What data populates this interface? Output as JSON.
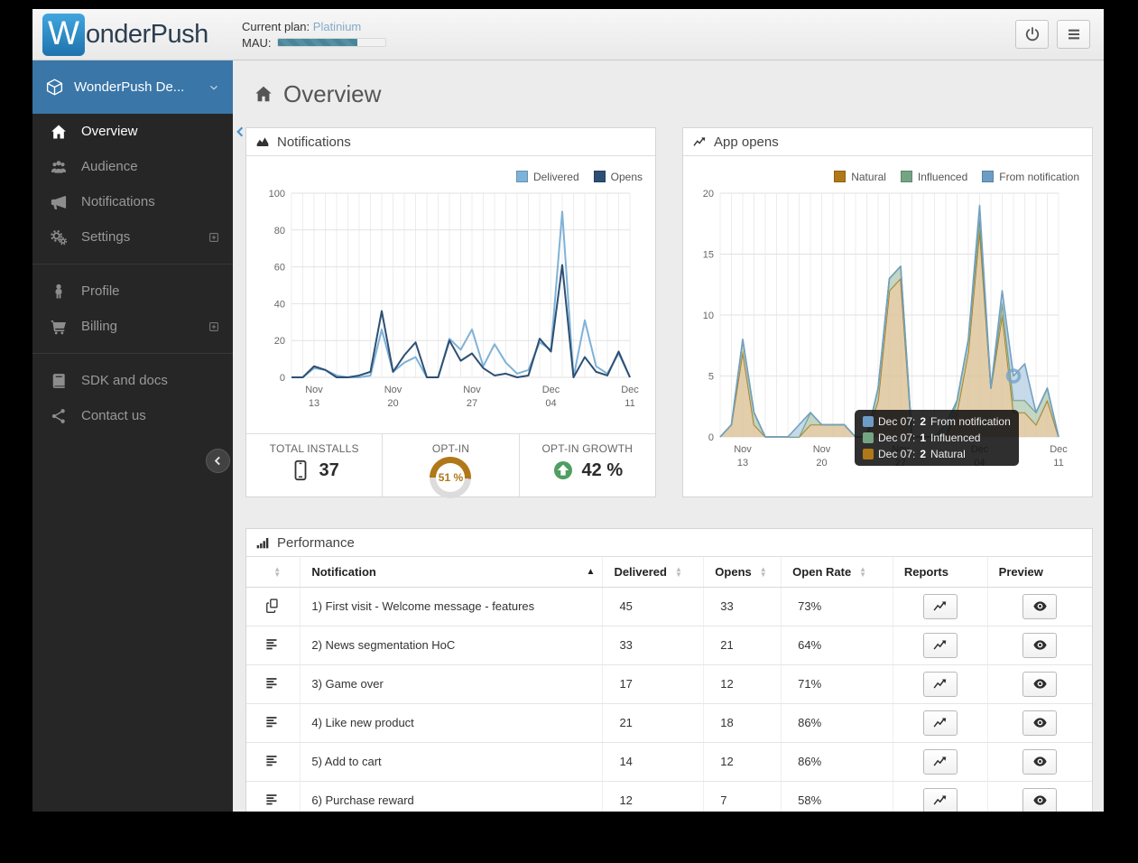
{
  "topbar": {
    "brand": {
      "logo_letter": "W",
      "name": "onderPush"
    },
    "plan": {
      "label": "Current plan:",
      "value": "Platinium"
    },
    "mau": {
      "label": "MAU:",
      "percent": 74
    }
  },
  "sidebar": {
    "app_selector": {
      "label": "WonderPush De...",
      "icon": "cube-icon"
    },
    "sections": [
      {
        "items": [
          {
            "label": "Overview",
            "icon": "home-icon",
            "active": true
          },
          {
            "label": "Audience",
            "icon": "users-icon"
          },
          {
            "label": "Notifications",
            "icon": "megaphone-icon"
          },
          {
            "label": "Settings",
            "icon": "gears-icon",
            "expandable": true
          }
        ]
      },
      {
        "items": [
          {
            "label": "Profile",
            "icon": "person-icon"
          },
          {
            "label": "Billing",
            "icon": "cart-icon",
            "expandable": true
          }
        ]
      },
      {
        "items": [
          {
            "label": "SDK and docs",
            "icon": "book-icon"
          },
          {
            "label": "Contact us",
            "icon": "share-icon"
          }
        ]
      }
    ]
  },
  "main": {
    "page_title": "Overview"
  },
  "panels": {
    "notifications": {
      "title": "Notifications",
      "legend": [
        {
          "label": "Delivered",
          "color": "#7fb2d8"
        },
        {
          "label": "Opens",
          "color": "#2e4f73"
        }
      ]
    },
    "app_opens": {
      "title": "App opens",
      "legend": [
        {
          "label": "Natural",
          "color": "#b07818"
        },
        {
          "label": "Influenced",
          "color": "#74a483"
        },
        {
          "label": "From notification",
          "color": "#6d9dc6"
        }
      ],
      "tooltip": [
        {
          "date": "Dec 07:",
          "value": "2",
          "label": "From notification",
          "color": "#6d9dc6"
        },
        {
          "date": "Dec 07:",
          "value": "1",
          "label": "Influenced",
          "color": "#74a483"
        },
        {
          "date": "Dec 07:",
          "value": "2",
          "label": "Natural",
          "color": "#b07818"
        }
      ]
    },
    "performance": {
      "title": "Performance",
      "columns": {
        "notification": "Notification",
        "delivered": "Delivered",
        "opens": "Opens",
        "open_rate": "Open Rate",
        "reports": "Reports",
        "preview": "Preview"
      },
      "rows": [
        {
          "icon": "copy-icon",
          "name": "1) First visit - Welcome message - features",
          "delivered": "45",
          "opens": "33",
          "open_rate": "73%"
        },
        {
          "icon": "text-lines-icon",
          "name": "2) News segmentation HoC",
          "delivered": "33",
          "opens": "21",
          "open_rate": "64%"
        },
        {
          "icon": "text-lines-icon",
          "name": "3) Game over",
          "delivered": "17",
          "opens": "12",
          "open_rate": "71%"
        },
        {
          "icon": "text-lines-icon",
          "name": "4) Like new product",
          "delivered": "21",
          "opens": "18",
          "open_rate": "86%"
        },
        {
          "icon": "text-lines-icon",
          "name": "5) Add to cart",
          "delivered": "14",
          "opens": "12",
          "open_rate": "86%"
        },
        {
          "icon": "text-lines-icon",
          "name": "6) Purchase reward",
          "delivered": "12",
          "opens": "7",
          "open_rate": "58%"
        }
      ]
    }
  },
  "stats": {
    "total_installs": {
      "label": "TOTAL INSTALLS",
      "value": "37",
      "icon": "phone-icon"
    },
    "opt_in": {
      "label": "OPT-IN",
      "value": "51 %",
      "percent": 51,
      "color": "#b07818"
    },
    "opt_in_growth": {
      "label": "OPT-IN GROWTH",
      "value": "42 %",
      "icon": "arrow-circle-up-icon"
    }
  },
  "chart_data": [
    {
      "id": "chart-notifications",
      "type": "line",
      "title": "Notifications",
      "x_tick_labels": [
        [
          "Nov",
          "13"
        ],
        [
          "Nov",
          "20"
        ],
        [
          "Nov",
          "27"
        ],
        [
          "Dec",
          "04"
        ],
        [
          "Dec",
          "11"
        ]
      ],
      "x_tick_indices": [
        2,
        9,
        16,
        23,
        30
      ],
      "ylim": [
        0,
        100
      ],
      "yticks": [
        0,
        20,
        40,
        60,
        80,
        100
      ],
      "grid": true,
      "legend_position": "top-right",
      "margins": {
        "l": 50,
        "r": 28,
        "t": 8,
        "b": 38
      },
      "series": [
        {
          "name": "Delivered",
          "color": "#7fb2d8",
          "values": [
            0,
            0,
            5,
            4,
            1,
            0,
            0,
            1,
            26,
            3,
            8,
            11,
            0,
            0,
            21,
            15,
            26,
            6,
            18,
            8,
            2,
            4,
            19,
            15,
            90,
            0,
            31,
            6,
            2,
            13,
            0
          ]
        },
        {
          "name": "Opens",
          "color": "#2e4f73",
          "values": [
            0,
            0,
            6,
            4,
            0,
            0,
            1,
            3,
            36,
            3,
            12,
            19,
            0,
            0,
            20,
            9,
            13,
            5,
            1,
            2,
            0,
            1,
            21,
            14,
            61,
            0,
            11,
            3,
            1,
            14,
            0
          ]
        }
      ]
    },
    {
      "id": "chart-appopens",
      "type": "area-stacked",
      "title": "App opens",
      "x_tick_labels": [
        [
          "Nov",
          "13"
        ],
        [
          "Nov",
          "20"
        ],
        [
          "Nov",
          "27"
        ],
        [
          "Dec",
          "04"
        ],
        [
          "Dec",
          "11"
        ]
      ],
      "x_tick_indices": [
        2,
        9,
        16,
        23,
        30
      ],
      "ylim": [
        0,
        20
      ],
      "yticks": [
        0,
        5,
        10,
        15,
        20
      ],
      "grid": true,
      "legend_position": "top-right",
      "margins": {
        "l": 41,
        "r": 37,
        "t": 8,
        "b": 37
      },
      "series": [
        {
          "name": "Natural",
          "stroke": "#a87b1d",
          "fill": "#dcc398",
          "values": [
            0,
            1,
            7,
            1,
            0,
            0,
            0,
            0,
            1,
            1,
            1,
            1,
            0,
            0,
            3,
            12,
            13,
            0,
            0,
            0,
            0,
            2,
            7,
            17,
            4,
            10,
            2,
            2,
            1,
            3,
            0
          ]
        },
        {
          "name": "Influenced",
          "stroke": "#6a9678",
          "fill": "#b7cdb7",
          "values": [
            0,
            0,
            1,
            1,
            0,
            0,
            0,
            0,
            1,
            0,
            0,
            0,
            0,
            0,
            1,
            1,
            1,
            0,
            0,
            0,
            0,
            1,
            1,
            1,
            0,
            1,
            1,
            1,
            1,
            1,
            0
          ]
        },
        {
          "name": "From notification",
          "stroke": "#72a0c1",
          "fill": "#b9d2e4",
          "values": [
            0,
            0,
            0,
            0,
            0,
            0,
            0,
            1,
            0,
            0,
            0,
            0,
            0,
            0,
            0,
            0,
            0,
            0,
            0,
            0,
            1,
            0,
            0,
            1,
            0,
            1,
            2,
            3,
            0,
            0,
            0
          ]
        }
      ],
      "hover": {
        "index": 26,
        "value": 5
      }
    }
  ]
}
